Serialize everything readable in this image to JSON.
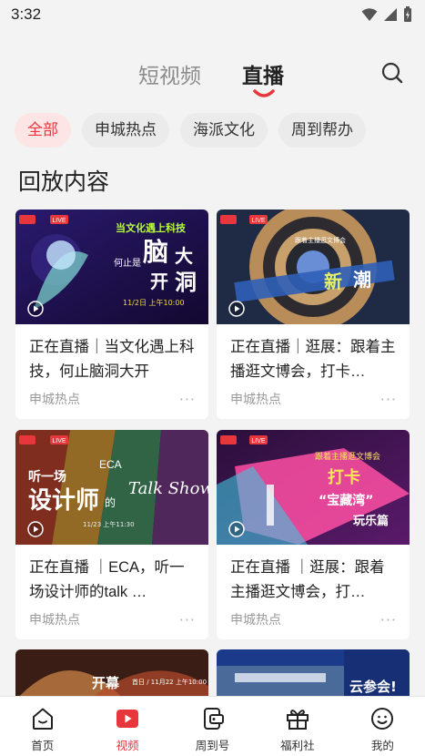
{
  "status_bar": {
    "time": "3:32"
  },
  "top_tabs": [
    {
      "label": "短视频",
      "active": false
    },
    {
      "label": "直播",
      "active": true
    }
  ],
  "search": {
    "icon": "search-icon"
  },
  "chips": [
    {
      "label": "全部",
      "active": true
    },
    {
      "label": "申城热点",
      "active": false
    },
    {
      "label": "海派文化",
      "active": false
    },
    {
      "label": "周到帮办",
      "active": false
    }
  ],
  "section_title": "回放内容",
  "cards": [
    {
      "title": "正在直播｜当文化遇上科技，何止脑洞大开",
      "source": "申城热点",
      "thumb_text": {
        "line1": "当文化遇上科技",
        "big1": "脑",
        "big2": "大",
        "small": "何止是",
        "big3": "开",
        "big4": "洞",
        "date": "11/2日 上午10:00",
        "badge": "LIVE"
      }
    },
    {
      "title": "正在直播｜逛展：跟着主播逛文博会，打卡…",
      "source": "申城热点",
      "thumb_text": {
        "line1": "跟着主播逛文博会",
        "big1": "新",
        "big2": "潮",
        "badge": "LIVE"
      }
    },
    {
      "title": "正在直播 ｜ECA，听一场设计师的talk …",
      "source": "申城热点",
      "thumb_text": {
        "line1": "听一场",
        "big1": "设计师",
        "small": "的",
        "script": "Talk Show",
        "eca": "ECA",
        "date": "11/23 上午11:30",
        "badge": "LIVE"
      }
    },
    {
      "title": "正在直播 ｜逛展：跟着主播逛文博会，打…",
      "source": "申城热点",
      "thumb_text": {
        "line1": "跟着主播逛文博会",
        "big1": "打卡",
        "big2": "“宝藏湾”",
        "big3": "玩乐篇",
        "badge": "LIVE"
      }
    }
  ],
  "partial_cards": [
    {
      "text": "开幕",
      "sub": "首日 / 11月22 上午10:00"
    },
    {
      "text": "云参会!"
    }
  ],
  "bottom_nav": [
    {
      "label": "首页",
      "icon": "home-icon",
      "active": false
    },
    {
      "label": "视频",
      "icon": "video-icon",
      "active": true
    },
    {
      "label": "周到号",
      "icon": "account-icon",
      "active": false
    },
    {
      "label": "福利社",
      "icon": "gift-icon",
      "active": false
    },
    {
      "label": "我的",
      "icon": "profile-icon",
      "active": false
    }
  ],
  "colors": {
    "accent": "#e8373c",
    "chip_bg": "#ebebeb",
    "page_bg": "#f3f3f3"
  }
}
